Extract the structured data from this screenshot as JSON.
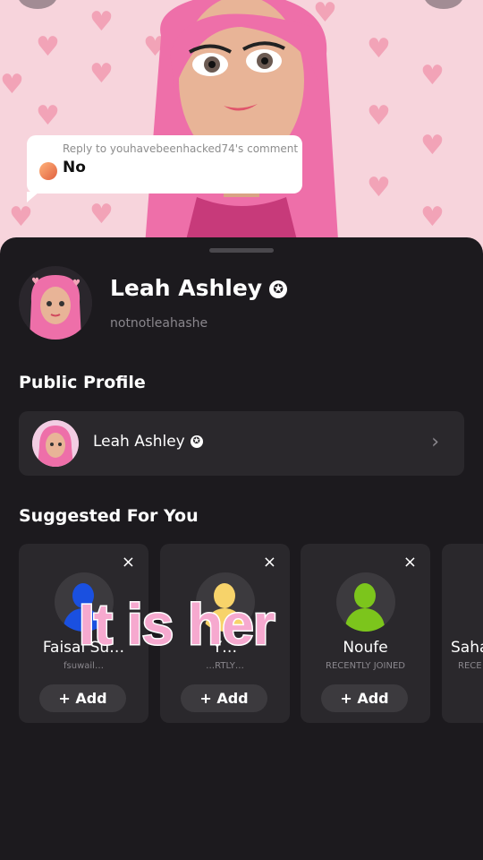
{
  "reply": {
    "header": "Reply to youhavebeenhacked74's comment",
    "text": "No"
  },
  "profile": {
    "name": "Leah Ashley",
    "username": "notnotleahashe",
    "verified_icon": "✪"
  },
  "public_profile": {
    "section_title": "Public Profile",
    "name": "Leah Ashley",
    "chevron": "›"
  },
  "suggested": {
    "section_title": "Suggested For You",
    "add_label": "+ Add",
    "close_glyph": "×",
    "cards": [
      {
        "name": "Faisal Su…",
        "sub": "fsuwail…",
        "color": "#1a50e0"
      },
      {
        "name": "Y…",
        "sub": "…RTLY…",
        "color": "#f7d36a"
      },
      {
        "name": "Noufe",
        "sub": "RECENTLY JOINED",
        "color": "#7cc51c"
      },
      {
        "name": "Saha",
        "sub": "RECE",
        "color": "#888888"
      }
    ]
  },
  "overlay": {
    "caption": "It is her"
  }
}
